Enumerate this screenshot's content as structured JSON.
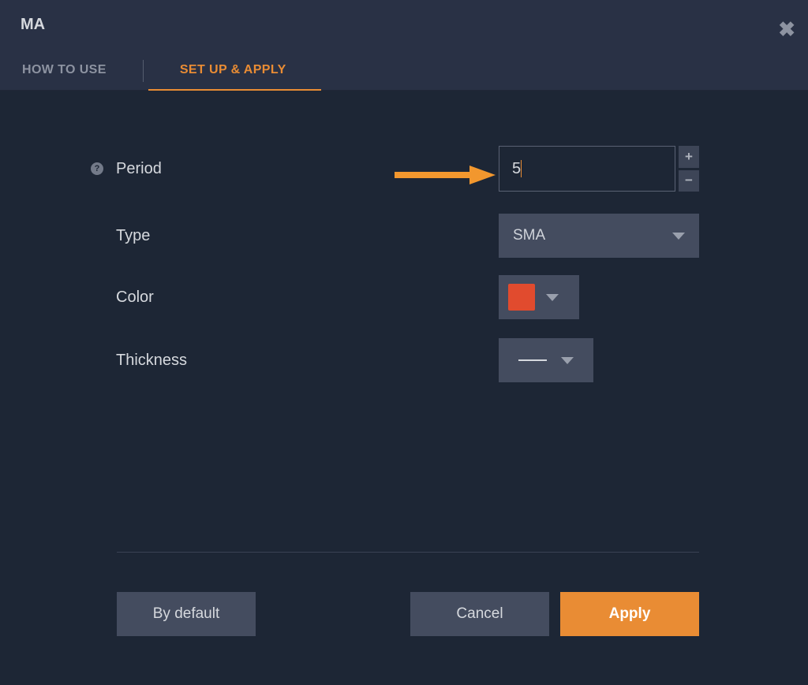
{
  "header": {
    "title": "MA"
  },
  "tabs": [
    {
      "label": "HOW TO USE",
      "active": false
    },
    {
      "label": "SET UP & APPLY",
      "active": true
    }
  ],
  "form": {
    "period": {
      "label": "Period",
      "value": "5"
    },
    "type": {
      "label": "Type",
      "selected": "SMA"
    },
    "color": {
      "label": "Color",
      "swatch": "#e14b2e"
    },
    "thickness": {
      "label": "Thickness"
    }
  },
  "footer": {
    "defaultBtn": "By default",
    "cancelBtn": "Cancel",
    "applyBtn": "Apply"
  },
  "icons": {
    "plus": "+",
    "minus": "−",
    "help": "?"
  },
  "annotation": {
    "arrowColor": "#f2972e"
  }
}
